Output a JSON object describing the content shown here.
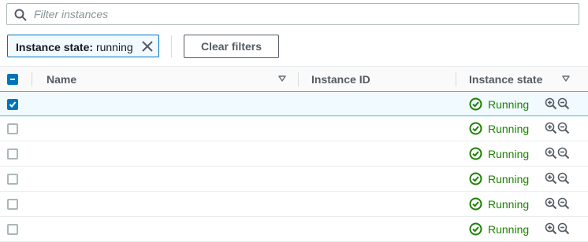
{
  "search": {
    "placeholder": "Filter instances",
    "value": ""
  },
  "filter_token": {
    "key": "Instance state:",
    "value": "running"
  },
  "clear_filters_label": "Clear filters",
  "columns": [
    {
      "label": "Name"
    },
    {
      "label": "Instance ID"
    },
    {
      "label": "Instance state"
    }
  ],
  "rows": [
    {
      "selected": true,
      "state": "Running"
    },
    {
      "selected": false,
      "state": "Running"
    },
    {
      "selected": false,
      "state": "Running"
    },
    {
      "selected": false,
      "state": "Running"
    },
    {
      "selected": false,
      "state": "Running"
    },
    {
      "selected": false,
      "state": "Running"
    }
  ],
  "colors": {
    "accent": "#0073bb",
    "running": "#1d8102",
    "selected_row_bg": "#f1faff",
    "selected_row_border": "#44b9d6"
  },
  "icons": {
    "search": "search-icon",
    "token_remove": "close-icon",
    "sort": "caret-down-icon",
    "status": "check-circle-icon",
    "zoom_in": "zoom-in-icon",
    "zoom_out": "zoom-out-icon"
  }
}
